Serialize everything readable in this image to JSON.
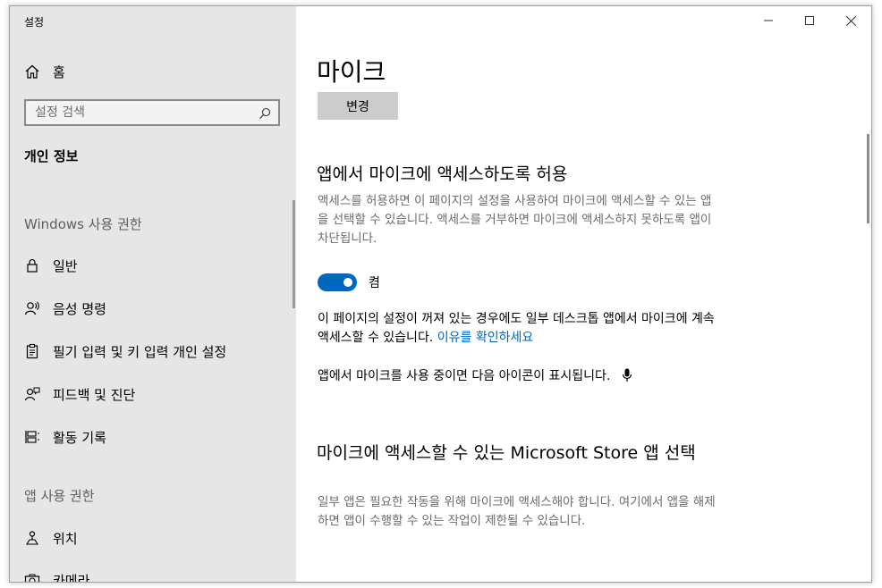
{
  "window": {
    "title": "설정"
  },
  "sidebar": {
    "home_label": "홈",
    "search_placeholder": "설정 검색",
    "active_section": "개인 정보",
    "windows_group": "Windows 사용 권한",
    "windows_items": [
      {
        "label": "일반",
        "icon": "lock-icon"
      },
      {
        "label": "음성 명령",
        "icon": "speech-icon"
      },
      {
        "label": "필기 입력 및 키 입력 개인 설정",
        "icon": "clipboard-icon"
      },
      {
        "label": "피드백 및 진단",
        "icon": "feedback-person-icon"
      },
      {
        "label": "활동 기록",
        "icon": "activity-history-icon"
      }
    ],
    "app_group": "앱 사용 권한",
    "app_items": [
      {
        "label": "위치",
        "icon": "location-icon"
      },
      {
        "label": "카메라",
        "icon": "camera-icon"
      }
    ]
  },
  "main": {
    "title": "마이크",
    "change_button": "변경",
    "allow_section": {
      "heading": "앱에서 마이크에 액세스하도록 허용",
      "description": "액세스를 허용하면 이 페이지의 설정을 사용하여 마이크에 액세스할 수 있는 앱을 선택할 수 있습니다. 액세스를 거부하면 마이크에 액세스하지 못하도록 앱이 차단됩니다.",
      "toggle_state": "켬",
      "toggle_on": true,
      "note": "이 페이지의 설정이 꺼져 있는 경우에도 일부 데스크톱 앱에서 마이크에 계속 액세스할 수 있습니다.",
      "note_link": "이유를 확인하세요",
      "indicator_text": "앱에서 마이크를 사용 중이면 다음 아이콘이 표시됩니다."
    },
    "store_section": {
      "heading": "마이크에 액세스할 수 있는 Microsoft Store 앱 선택",
      "description": "일부 앱은 필요한 작동을 위해 마이크에 액세스해야 합니다. 여기에서 앱을 해제하면 앱이 수행할 수 있는 작업이 제한될 수 있습니다."
    }
  },
  "colors": {
    "accent": "#0067c0",
    "sidebar_bg": "#e6e6e6",
    "button_bg": "#cccccc"
  }
}
